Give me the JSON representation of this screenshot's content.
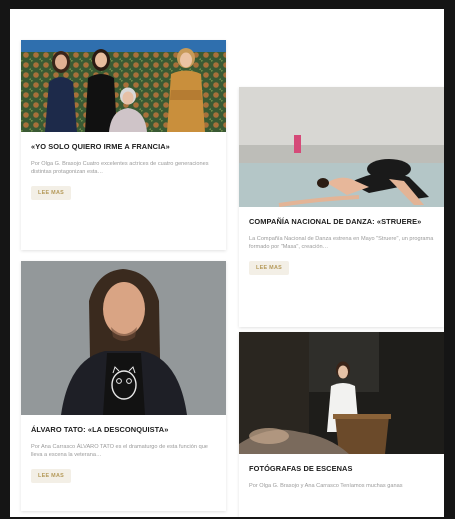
{
  "articles": [
    {
      "title": "«YO SOLO QUIERO IRME A FRANCIA»",
      "excerpt": "Por Olga G. Brasojo Cuatro excelentes actrices de cuatro generaciones distintas protagonizan esta…",
      "button": "LEE MAS",
      "image": "four-women-portrait-photo"
    },
    {
      "title": "COMPAÑÍA NACIONAL DE DANZA: «STRUERE»",
      "excerpt": "La Compañía Nacional de Danza estrena en Mayo \"Struere\", un programa formado por \"Masa\", creación…",
      "button": "LEE MAS",
      "image": "dancer-stage-photo"
    },
    {
      "title": "ÁLVARO TATO: «LA DESCONQUISTA»",
      "excerpt": "Por Ana Carrasco ÁLVARO TATO es el dramaturgo de esta función que lleva a escena la veterana…",
      "button": "LEE MAS",
      "image": "man-portrait-photo"
    },
    {
      "title": "FOTÓGRAFAS DE ESCENAS",
      "excerpt": "Por Olga G. Brasojo y Ana Carrasco Teníamos muchas ganas",
      "button": "",
      "image": "woman-at-lectern-photo"
    }
  ],
  "colors": {
    "page_background": "#151515",
    "card_background": "#ffffff",
    "title_text": "#1c1c1c",
    "excerpt_text": "#9a9a9a",
    "button_text": "#b59a5a",
    "button_background": "#f3efe6"
  }
}
